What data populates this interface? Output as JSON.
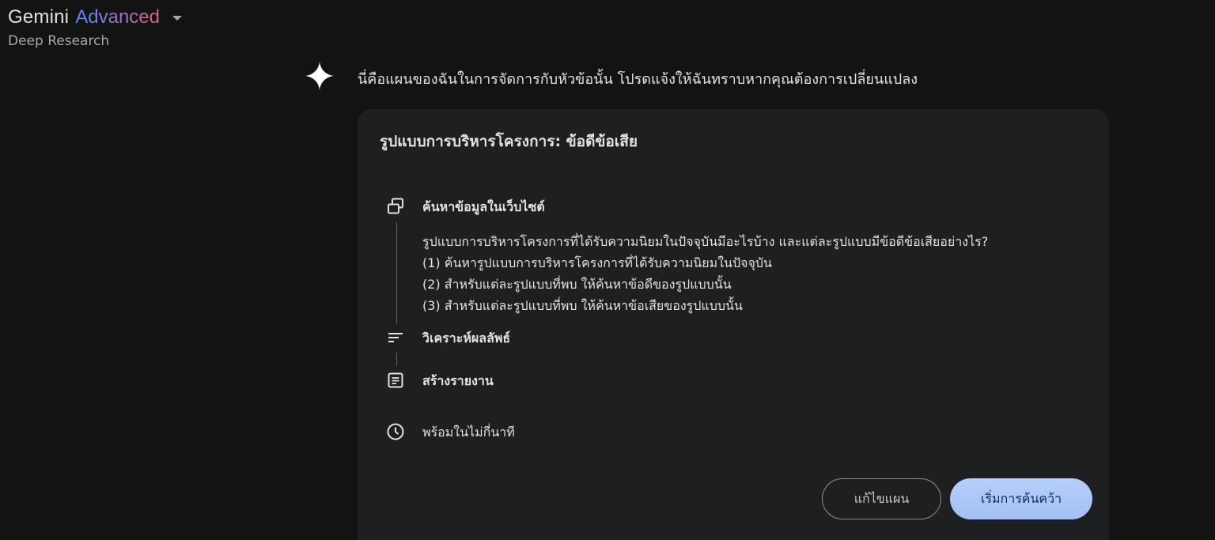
{
  "header": {
    "brand": "Gemini",
    "brand_tier": "Advanced",
    "mode": "Deep Research",
    "dropdown_icon": "caret-down-icon"
  },
  "message": {
    "avatar_icon": "gemini-sparkle-icon",
    "text": "นี่คือแผนของฉันในการจัดการกับหัวข้อนั้น โปรดแจ้งให้ฉันทราบหากคุณต้องการเปลี่ยนแปลง"
  },
  "plan": {
    "title": "รูปแบบการบริหารโครงการ: ข้อดีข้อเสีย",
    "steps": [
      {
        "icon": "web-search-icon",
        "label": "ค้นหาข้อมูลในเว็บไซต์",
        "details": [
          "รูปแบบการบริหารโครงการที่ได้รับความนิยมในปัจจุบันมีอะไรบ้าง และแต่ละรูปแบบมีข้อดีข้อเสียอย่างไร?",
          "(1) ค้นหารูปแบบการบริหารโครงการที่ได้รับความนิยมในปัจจุบัน",
          "(2) สำหรับแต่ละรูปแบบที่พบ ให้ค้นหาข้อดีของรูปแบบนั้น",
          "(3) สำหรับแต่ละรูปแบบที่พบ ให้ค้นหาข้อเสียของรูปแบบนั้น"
        ]
      },
      {
        "icon": "analyze-results-icon",
        "label": "วิเคราะห์ผลลัพธ์"
      },
      {
        "icon": "create-report-icon",
        "label": "สร้างรายงาน"
      }
    ],
    "eta": {
      "icon": "clock-icon",
      "label": "พร้อมในไม่กี่นาที"
    }
  },
  "buttons": {
    "edit_label": "แก้ไขแผน",
    "start_label": "เริ่มการค้นคว้า"
  },
  "colors": {
    "background": "#131314",
    "card": "#1e1f20",
    "primary_button": "#a8c7fa",
    "primary_button_text": "#062e6f"
  }
}
